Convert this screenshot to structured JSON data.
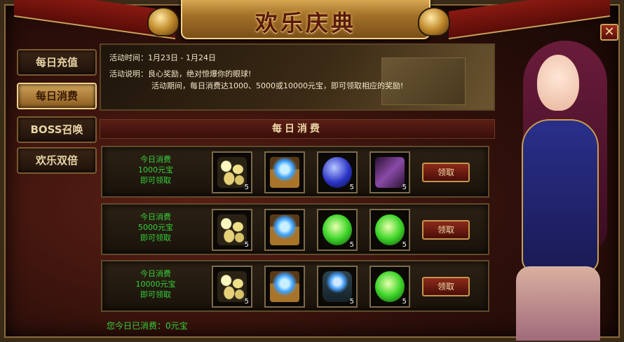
{
  "window": {
    "title": "欢乐庆典",
    "close_label": "✕"
  },
  "tabs": [
    {
      "label": "每日充值",
      "active": false
    },
    {
      "label": "每日消费",
      "active": true
    },
    {
      "label": "BOSS召唤",
      "active": false
    },
    {
      "label": "欢乐双倍",
      "active": false
    }
  ],
  "info": {
    "time_line": "活动时间：1月23日 - 1月24日",
    "desc_line": "活动说明：良心奖励，绝对惊爆你的眼球!",
    "desc_detail": "活动期间，每日消费达1000、5000或10000元宝，即可领取相应的奖励!"
  },
  "section": {
    "title": "每日消费"
  },
  "rows": [
    {
      "condition": [
        "今日消费",
        "1000元宝",
        "即可领取"
      ],
      "items": [
        {
          "icon": "ingots",
          "count": "5"
        },
        {
          "icon": "chest",
          "count": ""
        },
        {
          "icon": "orb-blue",
          "count": "5"
        },
        {
          "icon": "relic-purple",
          "count": "5"
        }
      ],
      "claim_label": "领取"
    },
    {
      "condition": [
        "今日消费",
        "5000元宝",
        "即可领取"
      ],
      "items": [
        {
          "icon": "ingots",
          "count": "5"
        },
        {
          "icon": "chest",
          "count": ""
        },
        {
          "icon": "orb-green",
          "count": "5"
        },
        {
          "icon": "orb-green",
          "count": "5"
        }
      ],
      "claim_label": "领取"
    },
    {
      "condition": [
        "今日消费",
        "10000元宝",
        "即可领取"
      ],
      "items": [
        {
          "icon": "ingots",
          "count": "5"
        },
        {
          "icon": "chest",
          "count": ""
        },
        {
          "icon": "armor",
          "count": "5"
        },
        {
          "icon": "orb-green",
          "count": "5"
        }
      ],
      "claim_label": "领取"
    }
  ],
  "footer": {
    "consumed": "您今日已消费：0元宝"
  }
}
